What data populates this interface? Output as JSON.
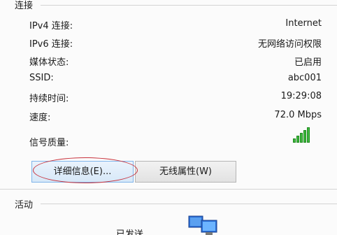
{
  "connection": {
    "title": "连接",
    "rows": [
      {
        "label": "IPv4 连接:",
        "value": "Internet"
      },
      {
        "label": "IPv6 连接:",
        "value": "无网络访问权限"
      },
      {
        "label": "媒体状态:",
        "value": "已启用"
      },
      {
        "label": "SSID:",
        "value": "abc001"
      },
      {
        "label": "持续时间:",
        "value": "19:29:08"
      },
      {
        "label": "速度:",
        "value": "72.0 Mbps"
      }
    ],
    "signal_label": "信号质量:",
    "signal_icon": "signal-strength-icon",
    "signal_bars": 5,
    "signal_bars_filled": 5,
    "details_button": "详细信息(E)...",
    "wireless_button": "无线属性(W)",
    "highlight_color": "#c8323c"
  },
  "activity": {
    "title": "活动",
    "sent_label": "已发送",
    "network_icon": "network-computers-icon"
  }
}
